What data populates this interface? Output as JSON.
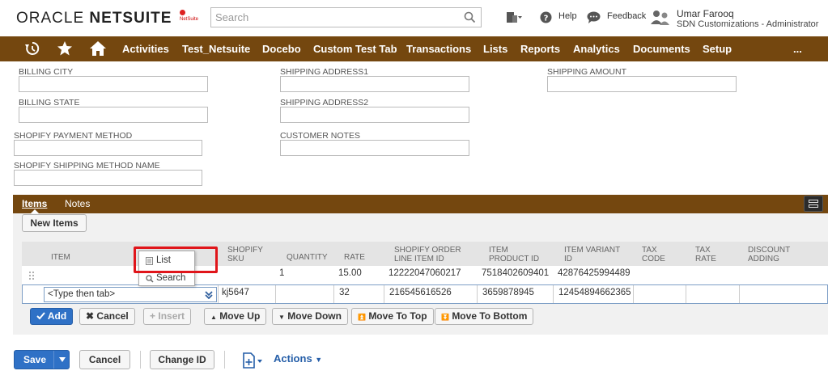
{
  "header": {
    "logo_oracle": "ORACLE",
    "logo_netsuite": "NETSUITE",
    "sandbox_label": "NetSuite",
    "search_placeholder": "Search",
    "help": "Help",
    "feedback": "Feedback",
    "user_name": "Umar Farooq",
    "user_role": "SDN Customizations - Administrator"
  },
  "nav": {
    "items": [
      "Activities",
      "Test_Netsuite",
      "Docebo",
      "Custom Test Tab",
      "Transactions",
      "Lists",
      "Reports",
      "Analytics",
      "Documents",
      "Setup"
    ],
    "more": "..."
  },
  "form": {
    "billing_city": "BILLING CITY",
    "billing_state": "BILLING STATE",
    "shopify_payment_method": "SHOPIFY PAYMENT METHOD",
    "shopify_shipping_method_name": "SHOPIFY SHIPPING METHOD NAME",
    "shipping_address1": "SHIPPING ADDRESS1",
    "shipping_address2": "SHIPPING ADDRESS2",
    "customer_notes": "CUSTOMER NOTES",
    "shipping_amount": "SHIPPING AMOUNT"
  },
  "subtabs": [
    "Items",
    "Notes"
  ],
  "new_items": "New Items",
  "grid": {
    "columns": [
      "ITEM",
      "SHOPIFY SKU",
      "QUANTITY",
      "RATE",
      "SHOPIFY ORDER LINE ITEM ID",
      "ITEM PRODUCT ID",
      "ITEM VARIANT ID",
      "TAX CODE",
      "TAX RATE",
      "DISCOUNT ADDING"
    ],
    "column_lines": [
      [
        "ITEM"
      ],
      [
        "SHOPIFY",
        "SKU"
      ],
      [
        "QUANTITY"
      ],
      [
        "RATE"
      ],
      [
        "SHOPIFY ORDER",
        "LINE ITEM ID"
      ],
      [
        "ITEM",
        "PRODUCT ID"
      ],
      [
        "ITEM VARIANT",
        "ID"
      ],
      [
        "TAX",
        "CODE"
      ],
      [
        "TAX",
        "RATE"
      ],
      [
        "DISCOUNT",
        "ADDING"
      ]
    ],
    "row1": {
      "quantity": "1",
      "rate": "15.00",
      "line_item_id": "12222047060217",
      "product_id": "7518402609401",
      "variant_id": "42876425994489"
    },
    "row2": {
      "item_placeholder": "<Type then tab>",
      "sku": "kj5647",
      "rate": "32",
      "line_item_id": "216545616526",
      "product_id": "3659878945",
      "variant_id": "12454894662365"
    }
  },
  "popup": {
    "list": "List",
    "search": "Search"
  },
  "row_buttons": {
    "add": "Add",
    "cancel": "Cancel",
    "insert": "Insert",
    "move_up": "Move Up",
    "move_down": "Move Down",
    "move_to_top": "Move To Top",
    "move_to_bottom": "Move To Bottom"
  },
  "footer": {
    "save": "Save",
    "cancel": "Cancel",
    "change_id": "Change ID",
    "actions": "Actions"
  },
  "colors": {
    "nav_brown": "#74470f",
    "primary_blue": "#2f71c6",
    "highlight_red": "#e0151a"
  }
}
